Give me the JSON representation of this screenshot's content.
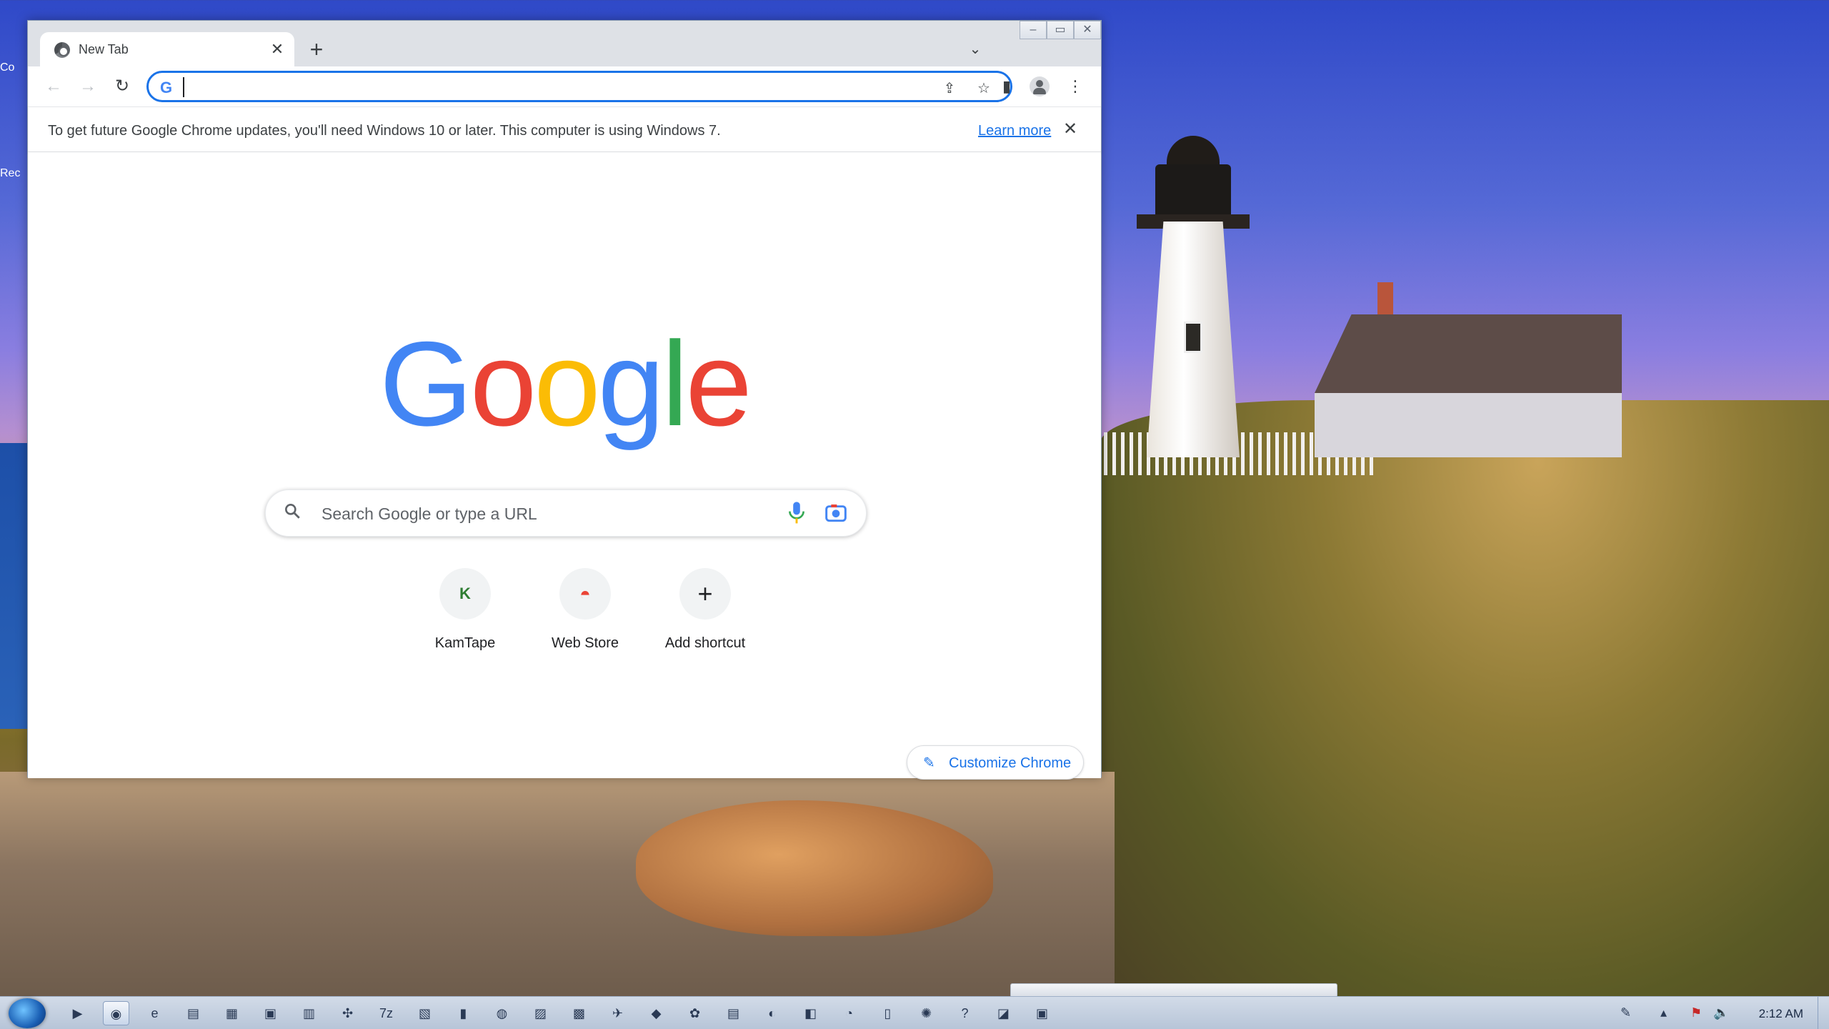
{
  "desktop": {
    "icon_labels": [
      "Co",
      "Rec"
    ]
  },
  "browser": {
    "tab": {
      "title": "New Tab",
      "close_glyph": "✕"
    },
    "new_tab_glyph": "+",
    "tab_search_glyph": "⌄",
    "window_buttons": {
      "minimize": "–",
      "maximize": "▭",
      "close": "✕"
    },
    "nav": {
      "back": "←",
      "forward": "→",
      "reload": "↻"
    },
    "omnibox": {
      "g_glyph": "G",
      "value": "",
      "placeholder": "",
      "share_glyph": "⇪",
      "star_glyph": "☆"
    },
    "toolbar_icons": {
      "side_panel": "▮",
      "menu": "⋮"
    },
    "infobar": {
      "message": "To get future Google Chrome updates, you'll need Windows 10 or later. This computer is using Windows 7.",
      "link": "Learn more",
      "close_glyph": "✕"
    },
    "ntp": {
      "logo_letters": [
        "G",
        "o",
        "o",
        "g",
        "l",
        "e"
      ],
      "search_icon": "🔍",
      "search_placeholder": "Search Google or type a URL",
      "shortcuts": [
        {
          "label": "KamTape",
          "icon": "K"
        },
        {
          "label": "Web Store",
          "icon": "◓"
        },
        {
          "label": "Add shortcut",
          "icon": "+"
        }
      ],
      "customize_icon": "✎",
      "customize_label": "Customize Chrome"
    }
  },
  "colors": {
    "accent": "#1a73e8",
    "logo": [
      "#4285f4",
      "#ea4335",
      "#fbbc05",
      "#4285f4",
      "#34a853",
      "#ea4335"
    ]
  },
  "taskbar": {
    "apps": [
      "▶",
      "◉",
      "e",
      "▤",
      "▦",
      "▣",
      "▥",
      "✣",
      "7z",
      "▧",
      "▮",
      "◍",
      "▨",
      "▩",
      "✈",
      "◆",
      "✿",
      "▤",
      "◐",
      "◧",
      "◔",
      "▯",
      "✺",
      "?",
      "◪",
      "▣"
    ],
    "tray": {
      "pen": "✎",
      "up": "▴",
      "flag": "⚑",
      "volume": "🔈"
    },
    "clock": "2:12 AM"
  }
}
